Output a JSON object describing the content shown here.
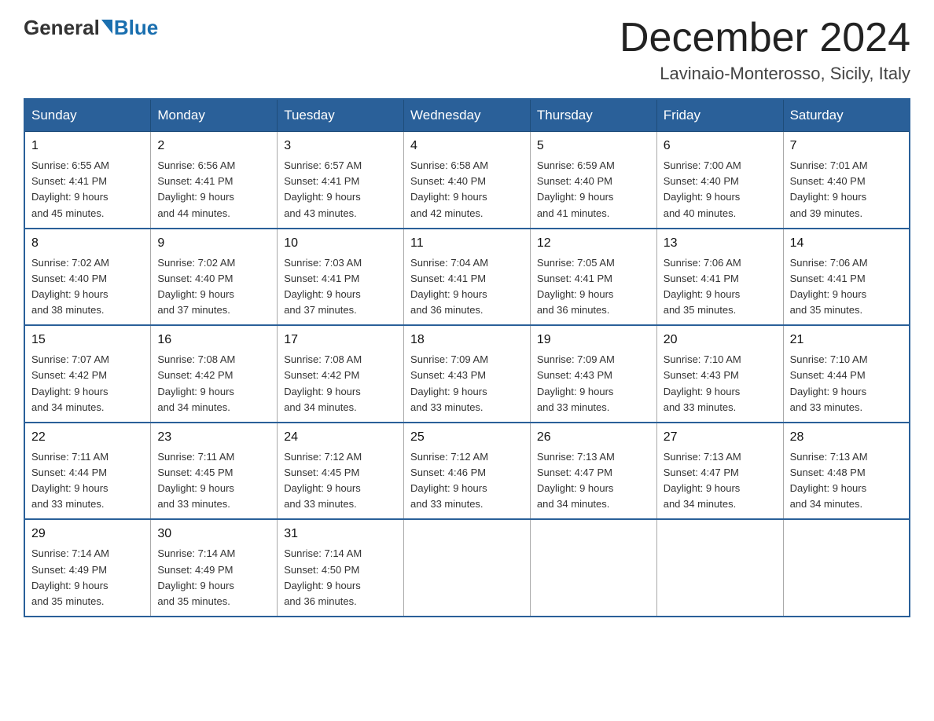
{
  "header": {
    "logo_general": "General",
    "logo_blue": "Blue",
    "title": "December 2024",
    "location": "Lavinaio-Monterosso, Sicily, Italy"
  },
  "days_of_week": [
    "Sunday",
    "Monday",
    "Tuesday",
    "Wednesday",
    "Thursday",
    "Friday",
    "Saturday"
  ],
  "weeks": [
    [
      {
        "day": "1",
        "sunrise": "6:55 AM",
        "sunset": "4:41 PM",
        "daylight": "9 hours and 45 minutes."
      },
      {
        "day": "2",
        "sunrise": "6:56 AM",
        "sunset": "4:41 PM",
        "daylight": "9 hours and 44 minutes."
      },
      {
        "day": "3",
        "sunrise": "6:57 AM",
        "sunset": "4:41 PM",
        "daylight": "9 hours and 43 minutes."
      },
      {
        "day": "4",
        "sunrise": "6:58 AM",
        "sunset": "4:40 PM",
        "daylight": "9 hours and 42 minutes."
      },
      {
        "day": "5",
        "sunrise": "6:59 AM",
        "sunset": "4:40 PM",
        "daylight": "9 hours and 41 minutes."
      },
      {
        "day": "6",
        "sunrise": "7:00 AM",
        "sunset": "4:40 PM",
        "daylight": "9 hours and 40 minutes."
      },
      {
        "day": "7",
        "sunrise": "7:01 AM",
        "sunset": "4:40 PM",
        "daylight": "9 hours and 39 minutes."
      }
    ],
    [
      {
        "day": "8",
        "sunrise": "7:02 AM",
        "sunset": "4:40 PM",
        "daylight": "9 hours and 38 minutes."
      },
      {
        "day": "9",
        "sunrise": "7:02 AM",
        "sunset": "4:40 PM",
        "daylight": "9 hours and 37 minutes."
      },
      {
        "day": "10",
        "sunrise": "7:03 AM",
        "sunset": "4:41 PM",
        "daylight": "9 hours and 37 minutes."
      },
      {
        "day": "11",
        "sunrise": "7:04 AM",
        "sunset": "4:41 PM",
        "daylight": "9 hours and 36 minutes."
      },
      {
        "day": "12",
        "sunrise": "7:05 AM",
        "sunset": "4:41 PM",
        "daylight": "9 hours and 36 minutes."
      },
      {
        "day": "13",
        "sunrise": "7:06 AM",
        "sunset": "4:41 PM",
        "daylight": "9 hours and 35 minutes."
      },
      {
        "day": "14",
        "sunrise": "7:06 AM",
        "sunset": "4:41 PM",
        "daylight": "9 hours and 35 minutes."
      }
    ],
    [
      {
        "day": "15",
        "sunrise": "7:07 AM",
        "sunset": "4:42 PM",
        "daylight": "9 hours and 34 minutes."
      },
      {
        "day": "16",
        "sunrise": "7:08 AM",
        "sunset": "4:42 PM",
        "daylight": "9 hours and 34 minutes."
      },
      {
        "day": "17",
        "sunrise": "7:08 AM",
        "sunset": "4:42 PM",
        "daylight": "9 hours and 34 minutes."
      },
      {
        "day": "18",
        "sunrise": "7:09 AM",
        "sunset": "4:43 PM",
        "daylight": "9 hours and 33 minutes."
      },
      {
        "day": "19",
        "sunrise": "7:09 AM",
        "sunset": "4:43 PM",
        "daylight": "9 hours and 33 minutes."
      },
      {
        "day": "20",
        "sunrise": "7:10 AM",
        "sunset": "4:43 PM",
        "daylight": "9 hours and 33 minutes."
      },
      {
        "day": "21",
        "sunrise": "7:10 AM",
        "sunset": "4:44 PM",
        "daylight": "9 hours and 33 minutes."
      }
    ],
    [
      {
        "day": "22",
        "sunrise": "7:11 AM",
        "sunset": "4:44 PM",
        "daylight": "9 hours and 33 minutes."
      },
      {
        "day": "23",
        "sunrise": "7:11 AM",
        "sunset": "4:45 PM",
        "daylight": "9 hours and 33 minutes."
      },
      {
        "day": "24",
        "sunrise": "7:12 AM",
        "sunset": "4:45 PM",
        "daylight": "9 hours and 33 minutes."
      },
      {
        "day": "25",
        "sunrise": "7:12 AM",
        "sunset": "4:46 PM",
        "daylight": "9 hours and 33 minutes."
      },
      {
        "day": "26",
        "sunrise": "7:13 AM",
        "sunset": "4:47 PM",
        "daylight": "9 hours and 34 minutes."
      },
      {
        "day": "27",
        "sunrise": "7:13 AM",
        "sunset": "4:47 PM",
        "daylight": "9 hours and 34 minutes."
      },
      {
        "day": "28",
        "sunrise": "7:13 AM",
        "sunset": "4:48 PM",
        "daylight": "9 hours and 34 minutes."
      }
    ],
    [
      {
        "day": "29",
        "sunrise": "7:14 AM",
        "sunset": "4:49 PM",
        "daylight": "9 hours and 35 minutes."
      },
      {
        "day": "30",
        "sunrise": "7:14 AM",
        "sunset": "4:49 PM",
        "daylight": "9 hours and 35 minutes."
      },
      {
        "day": "31",
        "sunrise": "7:14 AM",
        "sunset": "4:50 PM",
        "daylight": "9 hours and 36 minutes."
      },
      null,
      null,
      null,
      null
    ]
  ],
  "labels": {
    "sunrise": "Sunrise:",
    "sunset": "Sunset:",
    "daylight": "Daylight:"
  }
}
